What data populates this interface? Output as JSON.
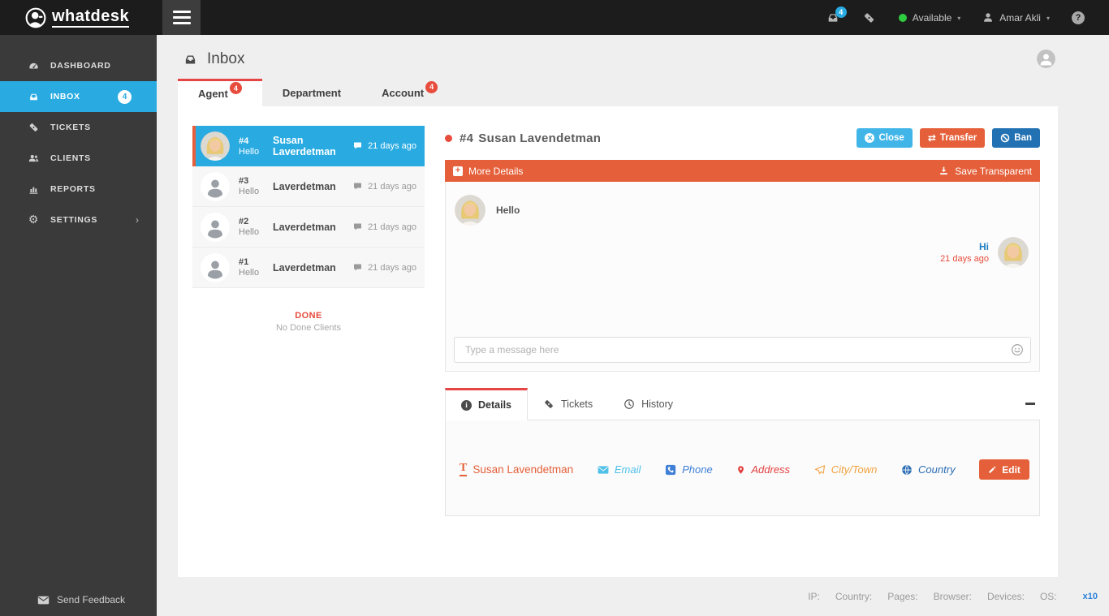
{
  "topbar": {
    "logo": "whatdesk",
    "inbox_badge": "4",
    "status_label": "Available",
    "user_name": "Amar Akli",
    "help_label": "?"
  },
  "sidebar": {
    "items": [
      {
        "label": "DASHBOARD"
      },
      {
        "label": "INBOX",
        "badge": "4",
        "active": true
      },
      {
        "label": "TICKETS"
      },
      {
        "label": "CLIENTS"
      },
      {
        "label": "REPORTS"
      },
      {
        "label": "SETTINGS",
        "chevron": "›"
      }
    ],
    "feedback_label": "Send Feedback"
  },
  "page": {
    "title": "Inbox",
    "tabs": [
      {
        "label": "Agent",
        "badge": "4",
        "active": true
      },
      {
        "label": "Department"
      },
      {
        "label": "Account",
        "badge": "4"
      }
    ]
  },
  "chat_list": {
    "items": [
      {
        "number": "#4",
        "preview": "Hello",
        "name": "Susan Laverdetman",
        "time": "21 days ago",
        "selected": true
      },
      {
        "number": "#3",
        "preview": "Hello",
        "name": "Laverdetman",
        "time": "21 days ago"
      },
      {
        "number": "#2",
        "preview": "Hello",
        "name": "Laverdetman",
        "time": "21 days ago"
      },
      {
        "number": "#1",
        "preview": "Hello",
        "name": "Laverdetman",
        "time": "21 days ago"
      }
    ],
    "done_label": "DONE",
    "done_empty": "No Done Clients"
  },
  "conversation": {
    "ticket_number": "#4",
    "client_name": "Susan Lavendetman",
    "buttons": {
      "close": "Close",
      "transfer": "Transfer",
      "ban": "Ban"
    },
    "more_details_label": "More Details",
    "save_transparent_label": "Save Transparent",
    "messages": [
      {
        "side": "left",
        "text": "Hello"
      },
      {
        "side": "right",
        "text": "Hi",
        "time": "21 days ago"
      }
    ],
    "input_placeholder": "Type a message here"
  },
  "details_panel": {
    "tabs": [
      {
        "label": "Details",
        "active": true
      },
      {
        "label": "Tickets"
      },
      {
        "label": "History"
      }
    ],
    "contact": {
      "name": "Susan Lavendetman",
      "fields": [
        "Email",
        "Phone",
        "Address",
        "City/Town",
        "Country"
      ],
      "edit_label": "Edit"
    }
  },
  "footer": {
    "labels": [
      "IP:",
      "Country:",
      "Pages:",
      "Browser:",
      "Devices:",
      "OS:"
    ],
    "multiplier": "x10"
  },
  "colors": {
    "accent_blue": "#29abe2",
    "orange": "#e5603a",
    "red": "#e74c3c",
    "ban_blue": "#2271b3",
    "online_green": "#2ecc40"
  }
}
